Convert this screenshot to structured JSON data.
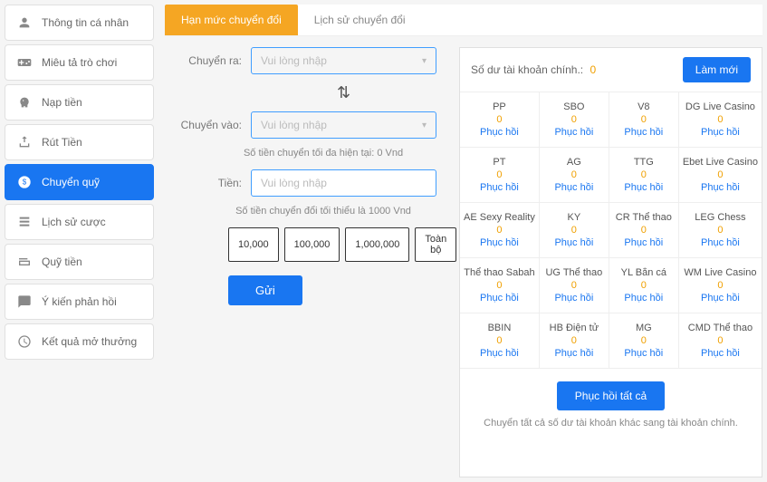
{
  "sidebar": {
    "items": [
      {
        "label": "Thông tin cá nhân"
      },
      {
        "label": "Miêu tả trò chơi"
      },
      {
        "label": "Nạp tiền"
      },
      {
        "label": "Rút Tiền"
      },
      {
        "label": "Chuyển quỹ"
      },
      {
        "label": "Lịch sử cược"
      },
      {
        "label": "Quỹ tiền"
      },
      {
        "label": "Ý kiến phản hồi"
      },
      {
        "label": "Kết quả mở thưởng"
      }
    ]
  },
  "tabs": {
    "limit": "Hạn mức chuyển đổi",
    "history": "Lịch sử chuyển đổi"
  },
  "form": {
    "from_label": "Chuyển ra:",
    "to_label": "Chuyển vào:",
    "amount_label": "Tiền:",
    "select_placeholder": "Vui lòng nhập",
    "input_placeholder": "Vui lòng nhập",
    "hint_current": "Số tiền chuyển tối đa hiện tại:  0 Vnd",
    "hint_min": "Số tiền chuyển đổi tối thiểu là 1000 Vnd",
    "amounts": [
      "10,000",
      "100,000",
      "1,000,000",
      "Toàn bộ"
    ],
    "submit": "Gửi"
  },
  "wallet": {
    "balance_label": "Số dư tài khoản chính.:",
    "balance_value": "0",
    "refresh": "Làm mới",
    "restore_label": "Phục hồi",
    "restore_all": "Phục hồi tất cả",
    "note": "Chuyển tất cả số dư tài khoản khác sang tài khoản chính.",
    "items": [
      {
        "name": "PP",
        "val": "0"
      },
      {
        "name": "SBO",
        "val": "0"
      },
      {
        "name": "V8",
        "val": "0"
      },
      {
        "name": "DG Live Casino",
        "val": "0"
      },
      {
        "name": "PT",
        "val": "0"
      },
      {
        "name": "AG",
        "val": "0"
      },
      {
        "name": "TTG",
        "val": "0"
      },
      {
        "name": "Ebet Live Casino",
        "val": "0"
      },
      {
        "name": "AE Sexy Reality",
        "val": "0"
      },
      {
        "name": "KY",
        "val": "0"
      },
      {
        "name": "CR Thể thao",
        "val": "0"
      },
      {
        "name": "LEG Chess",
        "val": "0"
      },
      {
        "name": "Thể thao Sabah",
        "val": "0"
      },
      {
        "name": "UG Thể thao",
        "val": "0"
      },
      {
        "name": "YL Bắn cá",
        "val": "0"
      },
      {
        "name": "WM Live Casino",
        "val": "0"
      },
      {
        "name": "BBIN",
        "val": "0"
      },
      {
        "name": "HB Điện tử",
        "val": "0"
      },
      {
        "name": "MG",
        "val": "0"
      },
      {
        "name": "CMD Thể thao",
        "val": "0"
      }
    ]
  }
}
